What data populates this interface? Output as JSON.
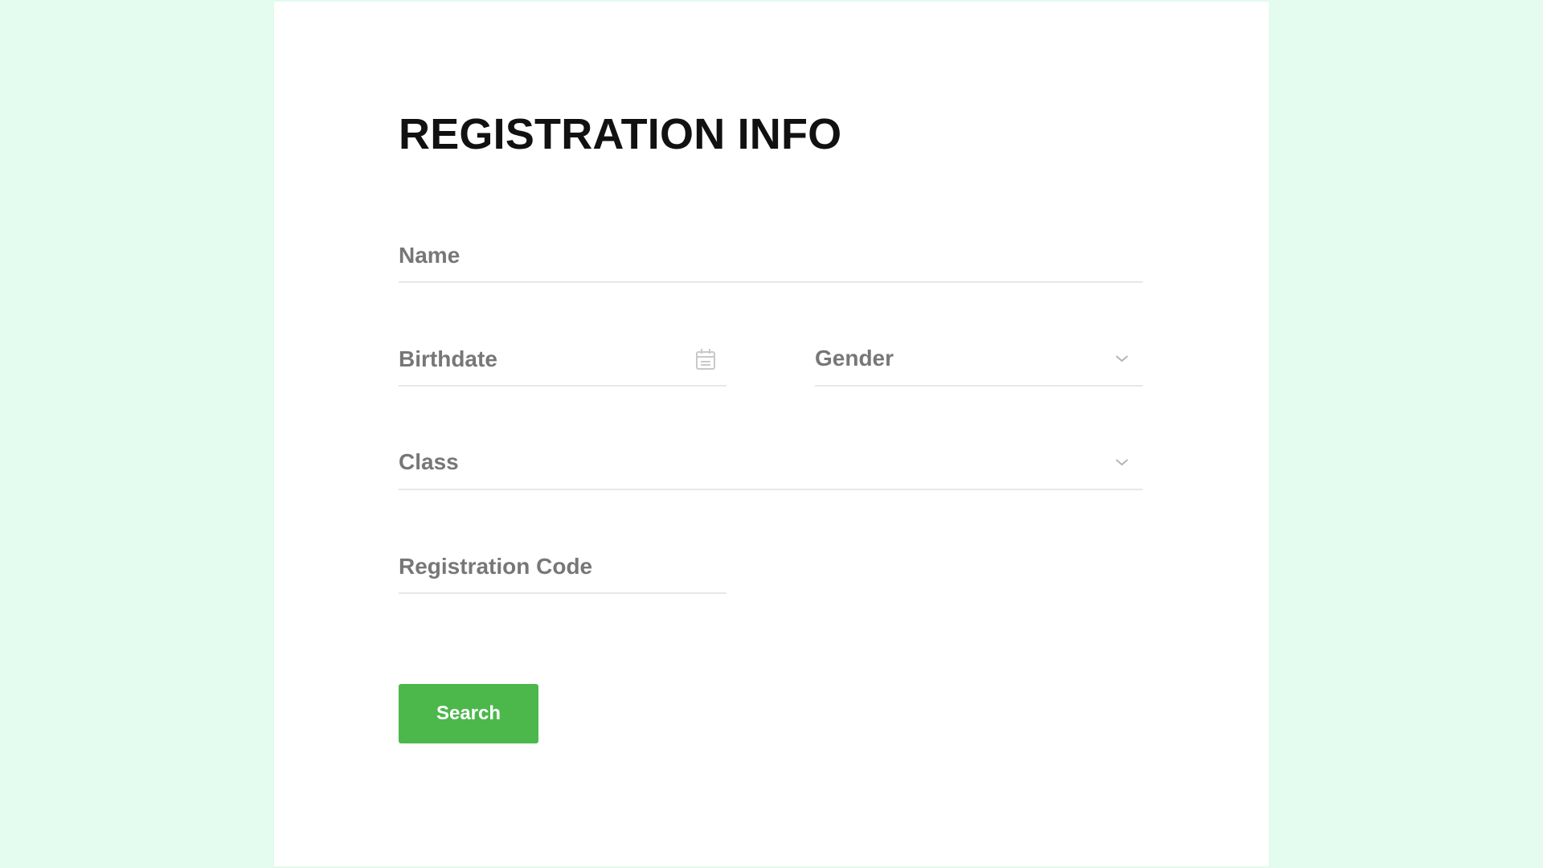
{
  "form": {
    "title": "REGISTRATION INFO",
    "name_placeholder": "Name",
    "birthdate_placeholder": "Birthdate",
    "gender_label": "Gender",
    "class_label": "Class",
    "registration_code_placeholder": "Registration Code",
    "search_label": "Search"
  },
  "colors": {
    "background": "#e3fcef",
    "card": "#ffffff",
    "accent_button": "#4cb84c",
    "placeholder_text": "#777777"
  },
  "icons": {
    "birthdate": "calendar-icon",
    "gender": "chevron-down-icon",
    "class": "chevron-down-icon"
  }
}
